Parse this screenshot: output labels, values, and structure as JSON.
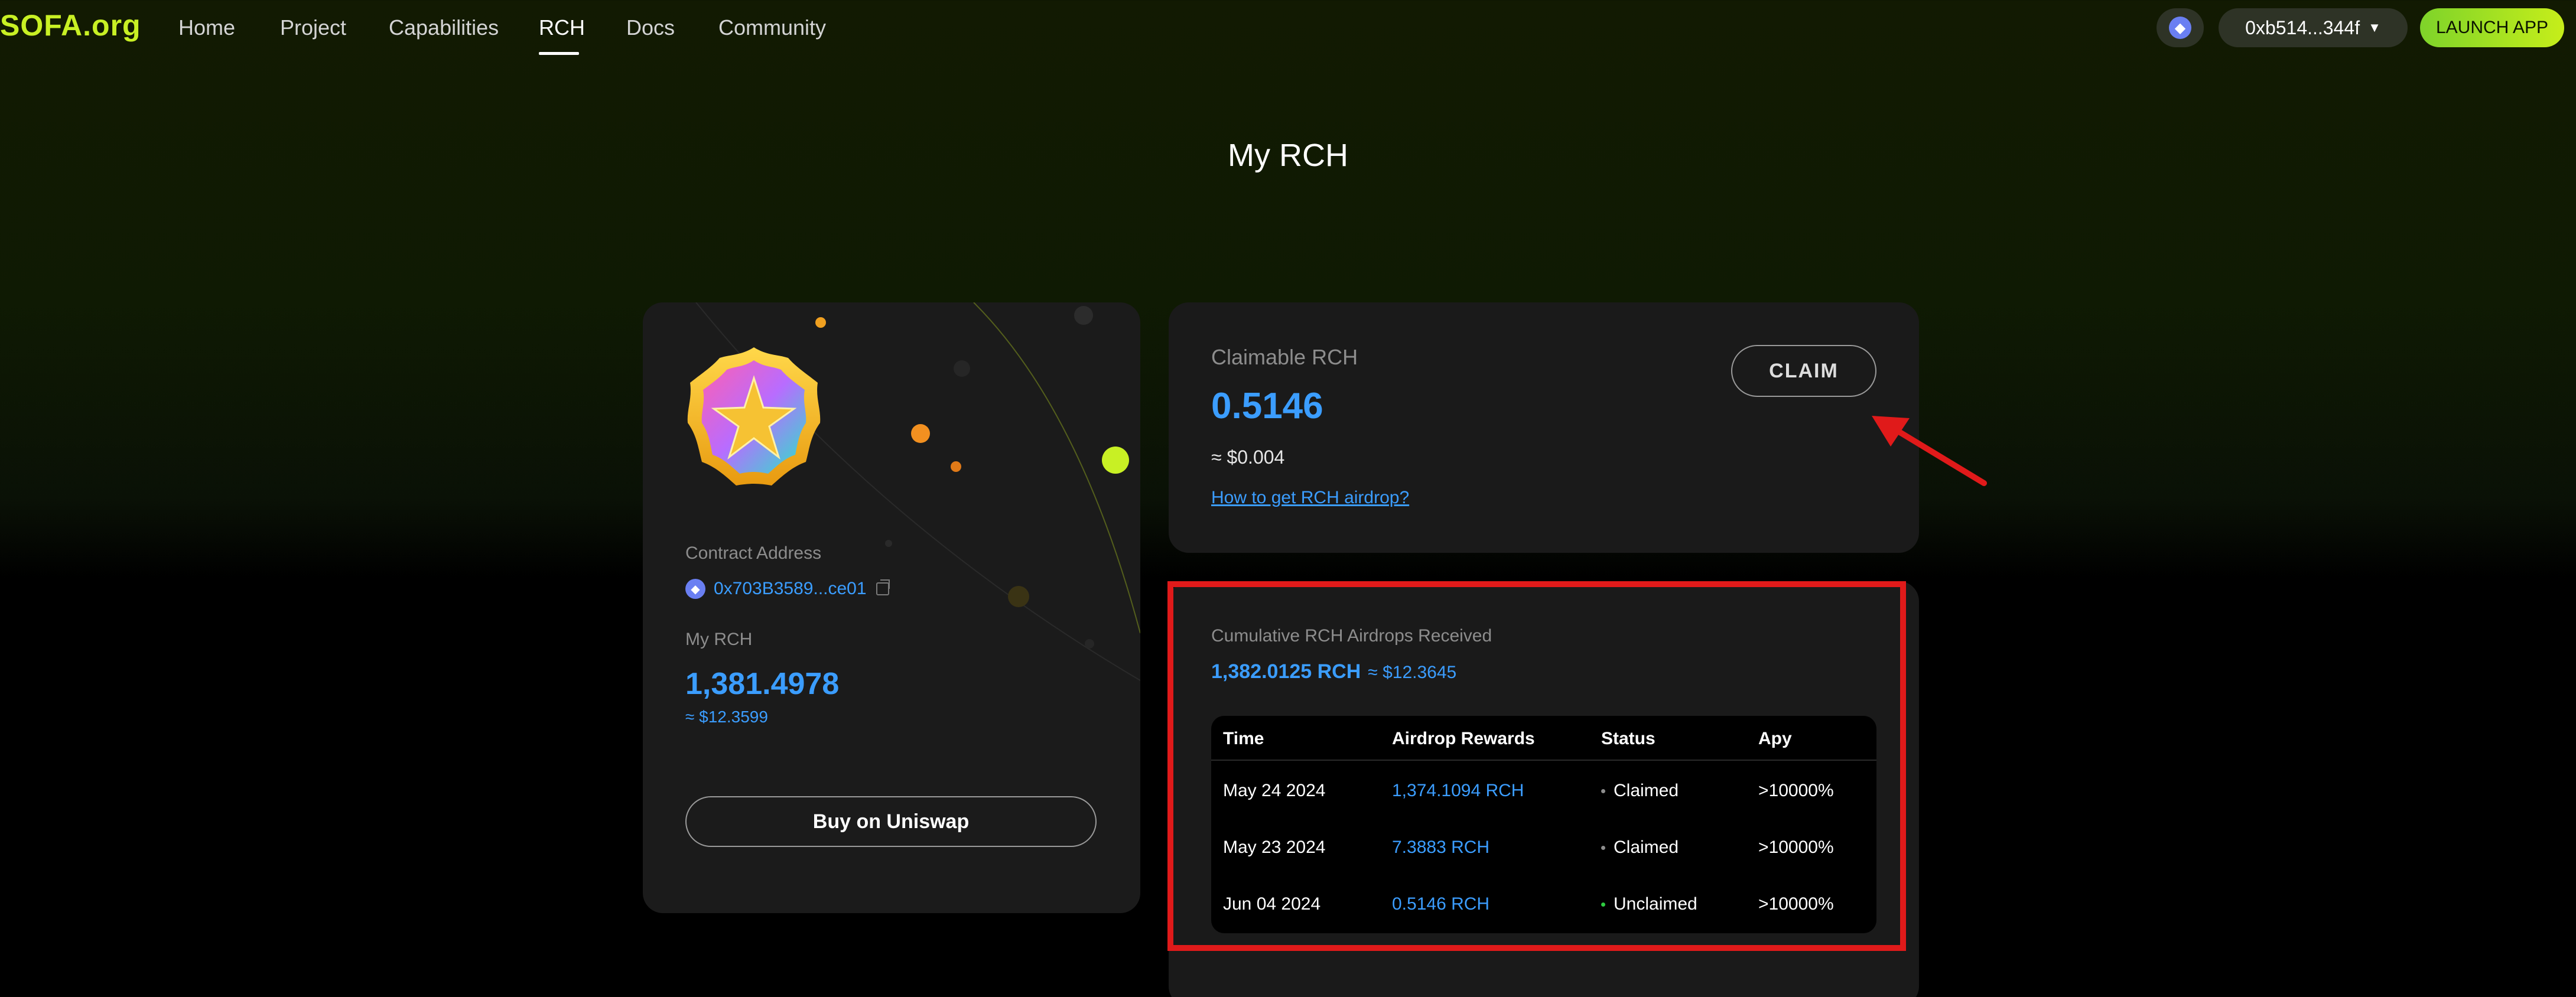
{
  "nav": {
    "logo": "SOFA.org",
    "links": [
      "Home",
      "Project",
      "Capabilities",
      "RCH",
      "Docs",
      "Community"
    ],
    "active": "RCH",
    "wallet": "0xb514...344f",
    "launch": "LAUNCH APP"
  },
  "page": {
    "title": "My RCH"
  },
  "token_card": {
    "contract_label": "Contract Address",
    "contract_address": "0x703B3589...ce01",
    "my_rch_label": "My RCH",
    "my_rch_value": "1,381.4978",
    "my_rch_usd": "≈ $12.3599",
    "buy_label": "Buy on Uniswap"
  },
  "claim_card": {
    "label": "Claimable RCH",
    "value": "0.5146",
    "usd": "≈ $0.004",
    "link": "How to get RCH airdrop?",
    "button": "CLAIM"
  },
  "cumulative": {
    "label": "Cumulative RCH Airdrops Received",
    "value": "1,382.0125 RCH",
    "usd": "≈ $12.3645",
    "columns": [
      "Time",
      "Airdrop Rewards",
      "Status",
      "Apy"
    ],
    "rows": [
      {
        "time": "May 24 2024",
        "reward": "1,374.1094 RCH",
        "status": "Claimed",
        "apy": ">10000%"
      },
      {
        "time": "May 23 2024",
        "reward": "7.3883 RCH",
        "status": "Claimed",
        "apy": ">10000%"
      },
      {
        "time": "Jun 04 2024",
        "reward": "0.5146 RCH",
        "status": "Unclaimed",
        "apy": ">10000%"
      }
    ]
  },
  "colors": {
    "accent_blue": "#3b9dff",
    "brand_green": "#c8f024",
    "annotation_red": "#e01a1a",
    "claimed_dot": "#8d8d8d",
    "unclaimed_dot": "#2ecc40"
  }
}
